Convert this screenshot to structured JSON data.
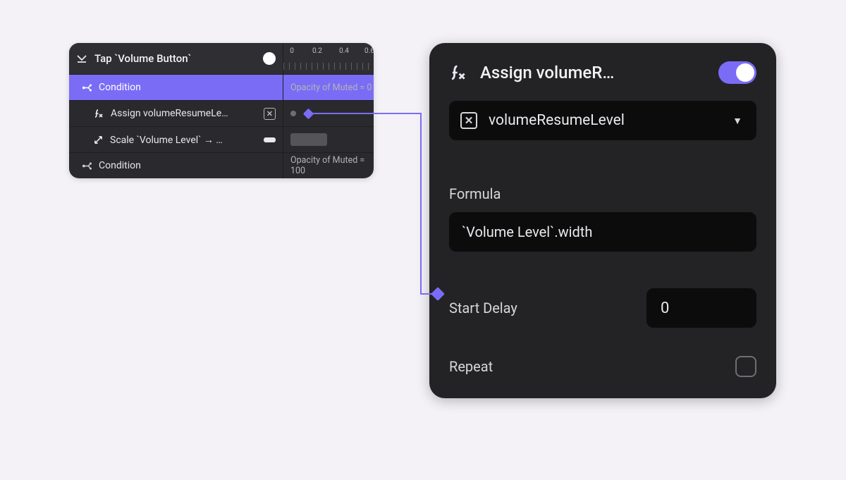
{
  "left": {
    "header_title": "Tap `Volume Button`",
    "ruler": {
      "labels": [
        "0",
        "0.2",
        "0.4",
        "0.6"
      ]
    },
    "rows": [
      {
        "kind": "condition",
        "label": "Condition",
        "right_text": "Opacity of Muted = 0",
        "selected": true,
        "indent": 1
      },
      {
        "kind": "assign",
        "label": "Assign volumeResumeLe…",
        "right": "diamond",
        "indent": 2
      },
      {
        "kind": "scale",
        "label": "Scale `Volume Level` → …",
        "right": "bar",
        "indent": 2
      },
      {
        "kind": "condition",
        "label": "Condition",
        "right_text": "Opacity of Muted = 100",
        "indent": 1
      }
    ]
  },
  "right": {
    "title": "Assign volumeR…",
    "toggle_on": true,
    "select": {
      "value": "volumeResumeLevel"
    },
    "formula_label": "Formula",
    "formula_value": "`Volume Level`.width",
    "start_delay_label": "Start Delay",
    "start_delay_value": "0",
    "repeat_label": "Repeat",
    "repeat_checked": false
  },
  "colors": {
    "accent": "#7b6cf6"
  }
}
